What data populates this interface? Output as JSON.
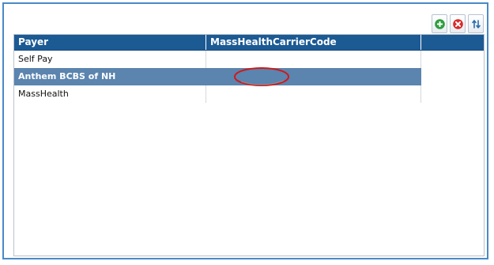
{
  "toolbar": {
    "add_icon": "plus-circle-icon",
    "add_color": "#2e9e3e",
    "delete_icon": "x-circle-icon",
    "delete_color": "#d92a2a",
    "refresh_icon": "refresh-icon",
    "refresh_color": "#2b6cb0"
  },
  "grid": {
    "columns": [
      "Payer",
      "MassHealthCarrierCode"
    ],
    "rows": [
      {
        "payer": "Self Pay",
        "code": ""
      },
      {
        "payer": "Anthem BCBS of NH",
        "code": ""
      },
      {
        "payer": "MassHealth",
        "code": ""
      }
    ],
    "selected_row": 1
  },
  "colors": {
    "header_bg": "#1c5a94",
    "selected_bg": "#5b84ae",
    "frame_border": "#4a8ac6",
    "annotation": "#d01818"
  }
}
